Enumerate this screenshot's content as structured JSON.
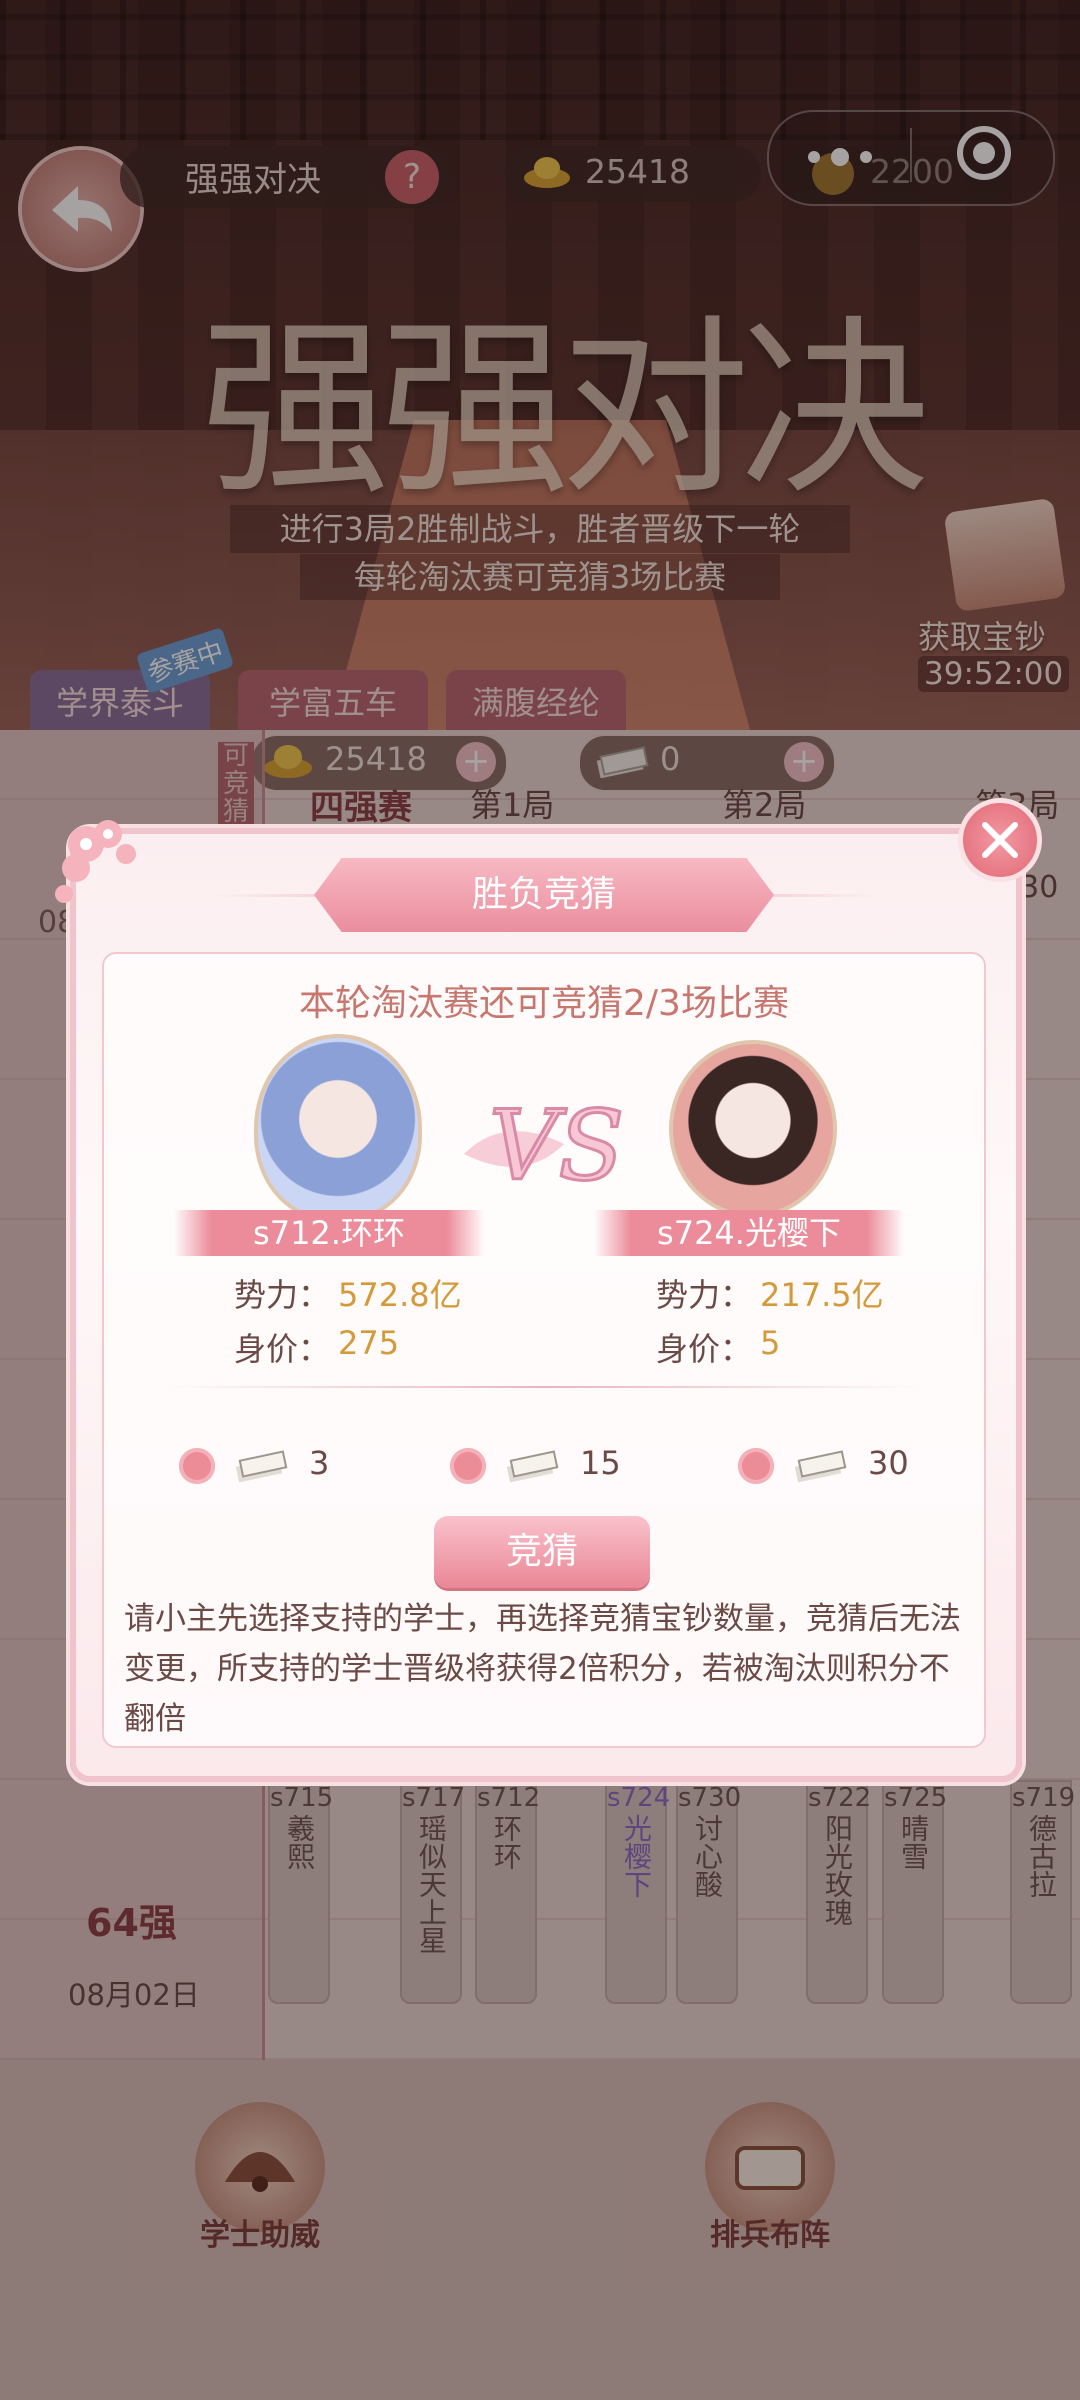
{
  "header": {
    "title": "强强对决",
    "help": "?",
    "gold": "25418",
    "coin": "2200",
    "banner_title": "强强对决",
    "rule_line1": "进行3局2胜制战斗，胜者晋级下一轮",
    "rule_line2": "每轮淘汰赛可竞猜3场比赛",
    "reward_label": "获取宝钞",
    "reward_timer": "39:52:00"
  },
  "tabs": [
    {
      "label": "学界泰斗",
      "badge": "参赛中"
    },
    {
      "label": "学富五车"
    },
    {
      "label": "满腹经纶"
    }
  ],
  "resources": {
    "gold": "25418",
    "tickets": "0"
  },
  "bracket": {
    "side_label": "可竞猜",
    "stage": "四强赛",
    "rounds": [
      "第1局",
      "第2局",
      "第3局"
    ],
    "time_partial": ":30",
    "date_partial": "08",
    "stage64": "64强",
    "date64": "08月02日",
    "players": [
      {
        "id": "s715",
        "name": "羲熙"
      },
      {
        "id": "s717",
        "name": "瑶似天上星"
      },
      {
        "id": "s712",
        "name": "环环"
      },
      {
        "id": "s724",
        "name": "光樱下"
      },
      {
        "id": "s730",
        "name": "讨心酸"
      },
      {
        "id": "s722",
        "name": "阳光玫瑰"
      },
      {
        "id": "s725",
        "name": "晴雪"
      },
      {
        "id": "s719",
        "name": "德古拉"
      }
    ]
  },
  "modal": {
    "title": "胜负竞猜",
    "subtitle": "本轮淘汰赛还可竞猜2/3场比赛",
    "left": {
      "name": "s712.环环",
      "power_label": "势力：",
      "power": "572.8亿",
      "worth_label": "身价：",
      "worth": "275"
    },
    "right": {
      "name": "s724.光樱下",
      "power_label": "势力：",
      "power": "217.5亿",
      "worth_label": "身价：",
      "worth": "5"
    },
    "vs": "VS",
    "options": [
      "3",
      "15",
      "30"
    ],
    "button": "竞猜",
    "description": "请小主先选择支持的学士，再选择竞猜宝钞数量，竞猜后无法变更，所支持的学士晋级将获得2倍积分，若被淘汰则积分不翻倍"
  },
  "bottom": {
    "left_button": "学士助威",
    "right_button": "排兵布阵"
  },
  "colors": {
    "accent": "#ec8c9a",
    "value": "#d49a3a",
    "text": "#6b4a45"
  }
}
